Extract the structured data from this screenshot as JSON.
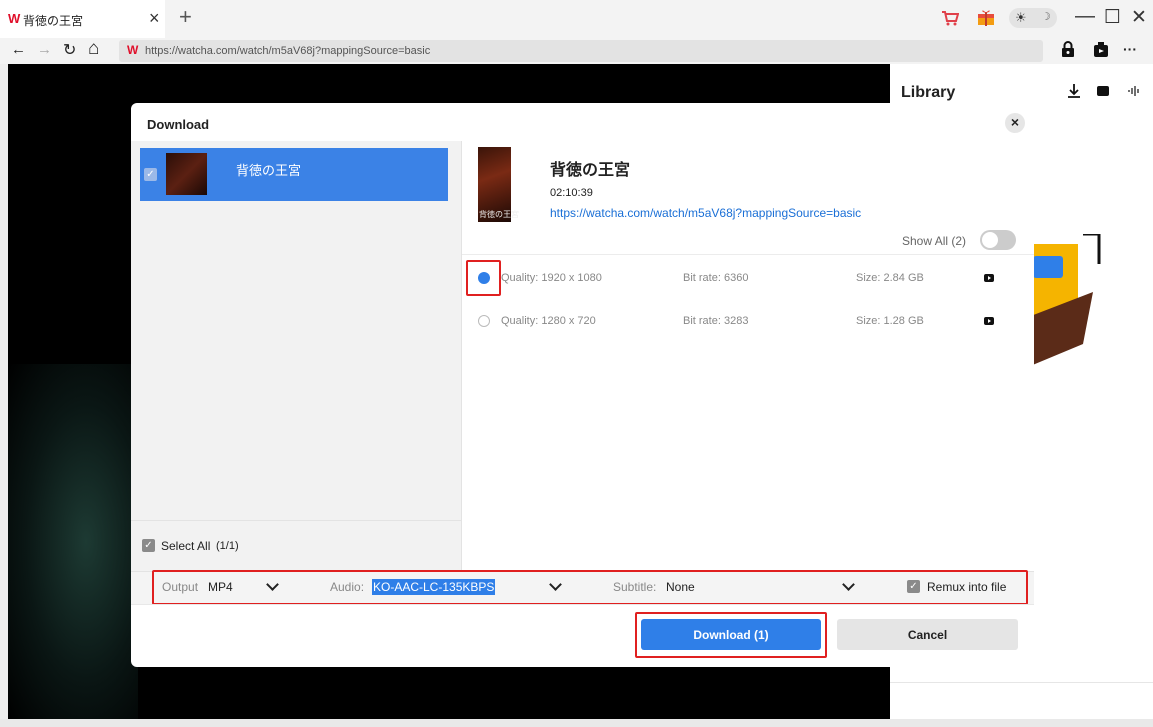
{
  "tab": {
    "favicon": "W",
    "title": "背徳の王宮",
    "close": "×",
    "new_tab": "+"
  },
  "nav": {
    "back": "←",
    "forward": "→",
    "reload": "↻",
    "home": "⌂",
    "url_favicon": "W",
    "url": "https://watcha.com/watch/m5aV68j?mappingSource=basic",
    "more": "···"
  },
  "window_controls": {
    "minimize": "—",
    "maximize": "☐",
    "close": "✕"
  },
  "library": {
    "title": "Library"
  },
  "dialog": {
    "title": "Download",
    "close": "×",
    "list": [
      {
        "title": "背徳の王宮",
        "checked": true
      }
    ],
    "select_all_label": "Select All",
    "select_all_count": "(1/1)",
    "video": {
      "title": "背徳の王宮",
      "duration": "02:10:39",
      "url": "https://watcha.com/watch/m5aV68j?mappingSource=basic",
      "poster_text": "背徳の王宮"
    },
    "show_all": "Show All (2)",
    "qualities": [
      {
        "quality": "Quality: 1920 x 1080",
        "bitrate": "Bit rate: 6360",
        "size": "Size: 2.84 GB",
        "selected": true
      },
      {
        "quality": "Quality: 1280 x 720",
        "bitrate": "Bit rate: 3283",
        "size": "Size: 1.28 GB",
        "selected": false
      }
    ],
    "output_label": "Output",
    "output_value": "MP4",
    "audio_label": "Audio:",
    "audio_value": "KO-AAC-LC-135KBPS",
    "subtitle_label": "Subtitle:",
    "subtitle_value": "None",
    "remux_label": "Remux into file",
    "download_btn": "Download (1)",
    "cancel_btn": "Cancel"
  },
  "colors": {
    "accent": "#2f7fe8",
    "highlight": "#e02020",
    "link": "#1a6fd6",
    "selected_row": "#3b82e6"
  }
}
